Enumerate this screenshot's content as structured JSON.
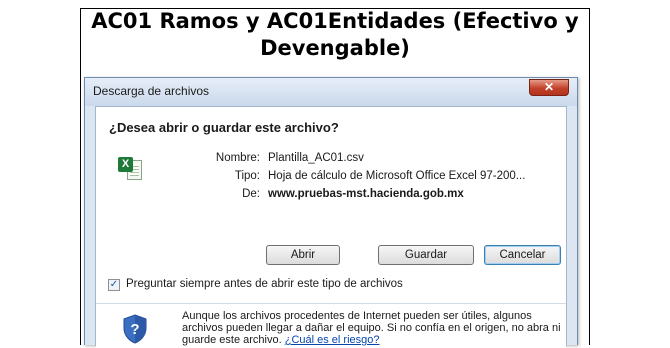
{
  "slide": {
    "title_line1": "AC01 Ramos y AC01Entidades (Efectivo y",
    "title_line2": "Devengable)"
  },
  "dialog": {
    "title": "Descarga de archivos",
    "close_glyph": "✕",
    "question": "¿Desea abrir o guardar este archivo?",
    "file_icon": "excel-csv-icon",
    "fields": {
      "name_label": "Nombre:",
      "name_value": "Plantilla_AC01.csv",
      "type_label": "Tipo:",
      "type_value": "Hoja de cálculo de Microsoft Office Excel 97-200...",
      "from_label": "De:",
      "from_value": "www.pruebas-mst.hacienda.gob.mx"
    },
    "buttons": {
      "open": "Abrir",
      "save": "Guardar",
      "cancel": "Cancelar"
    },
    "always_ask": {
      "checked": true,
      "label": "Preguntar siempre antes de abrir este tipo de archivos"
    },
    "warning": {
      "icon": "security-shield-icon",
      "text": "Aunque los archivos procedentes de Internet pueden ser útiles, algunos archivos pueden llegar a dañar el equipo. Si no confía en el origen, no abra ni guarde este archivo.",
      "link": "¿Cuál es el riesgo?"
    }
  },
  "colors": {
    "dialog_bg": "#dce6f3",
    "close_button": "#c2412a",
    "link": "#0645ad"
  }
}
